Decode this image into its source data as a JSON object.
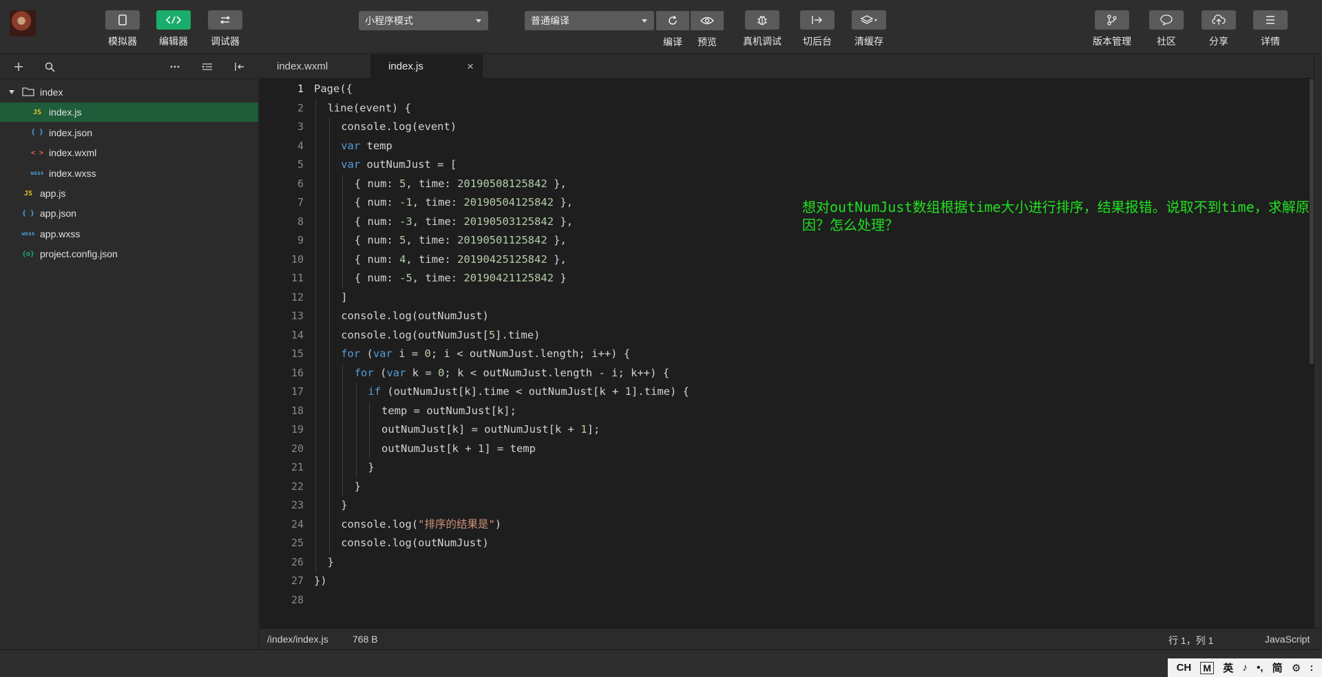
{
  "toolbar": {
    "left_buttons": [
      {
        "label": "模拟器",
        "icon": "phone-icon",
        "active": false
      },
      {
        "label": "编辑器",
        "icon": "code-icon",
        "active": true
      },
      {
        "label": "调试器",
        "icon": "debug-toggle-icon",
        "active": false
      }
    ],
    "mode_select": "小程序模式",
    "compile_select": "普通编译",
    "compile_label": "编译",
    "preview_label": "预览",
    "actions": [
      {
        "label": "真机调试",
        "icon": "bug-icon"
      },
      {
        "label": "切后台",
        "icon": "switch-background-icon"
      },
      {
        "label": "清缓存",
        "icon": "layers-icon"
      }
    ],
    "right_buttons": [
      {
        "label": "版本管理",
        "icon": "branch-icon"
      },
      {
        "label": "社区",
        "icon": "chat-icon"
      },
      {
        "label": "分享",
        "icon": "cloud-upload-icon"
      },
      {
        "label": "详情",
        "icon": "menu-icon"
      }
    ],
    "active_color": "#1aad6b"
  },
  "sidebar": {
    "tree": [
      {
        "label": "index",
        "type": "folder",
        "icon_text": "",
        "color": "#cfcfcf",
        "selected": false
      },
      {
        "label": "index.js",
        "type": "js",
        "icon_text": "JS",
        "color": "#e6c229",
        "selected": true
      },
      {
        "label": "index.json",
        "type": "json",
        "icon_text": "{ }",
        "color": "#4aa3df",
        "selected": false
      },
      {
        "label": "index.wxml",
        "type": "wxml",
        "icon_text": "< >",
        "color": "#e9663c",
        "selected": false
      },
      {
        "label": "index.wxss",
        "type": "wxss",
        "icon_text": "wxss",
        "color": "#4aa3df",
        "selected": false
      },
      {
        "label": "app.js",
        "type": "js",
        "icon_text": "JS",
        "color": "#e6c229",
        "selected": false
      },
      {
        "label": "app.json",
        "type": "json",
        "icon_text": "{ }",
        "color": "#4aa3df",
        "selected": false
      },
      {
        "label": "app.wxss",
        "type": "wxss",
        "icon_text": "wxss",
        "color": "#4aa3df",
        "selected": false
      },
      {
        "label": "project.config.json",
        "type": "config",
        "icon_text": "{o}",
        "color": "#1aad6b",
        "selected": false
      }
    ]
  },
  "tabs": [
    {
      "label": "index.wxml",
      "active": false
    },
    {
      "label": "index.js",
      "active": true,
      "close": "×"
    }
  ],
  "editor": {
    "current_line": 1,
    "lines": [
      {
        "indent": 0,
        "parts": [
          [
            "p",
            "Page({"
          ]
        ]
      },
      {
        "indent": 1,
        "parts": [
          [
            "p",
            "line(event) {"
          ]
        ]
      },
      {
        "indent": 2,
        "parts": [
          [
            "p",
            "console.log(event)"
          ]
        ]
      },
      {
        "indent": 2,
        "parts": [
          [
            "k",
            "var"
          ],
          [
            "p",
            " temp"
          ]
        ]
      },
      {
        "indent": 2,
        "parts": [
          [
            "k",
            "var"
          ],
          [
            "p",
            " outNumJust = ["
          ]
        ]
      },
      {
        "indent": 3,
        "parts": [
          [
            "p",
            "{ num: "
          ],
          [
            "n",
            "5"
          ],
          [
            "p",
            ", time: "
          ],
          [
            "n",
            "20190508125842"
          ],
          [
            "p",
            " },"
          ]
        ]
      },
      {
        "indent": 3,
        "parts": [
          [
            "p",
            "{ num: "
          ],
          [
            "n",
            "-1"
          ],
          [
            "p",
            ", time: "
          ],
          [
            "n",
            "20190504125842"
          ],
          [
            "p",
            " },"
          ]
        ]
      },
      {
        "indent": 3,
        "parts": [
          [
            "p",
            "{ num: "
          ],
          [
            "n",
            "-3"
          ],
          [
            "p",
            ", time: "
          ],
          [
            "n",
            "20190503125842"
          ],
          [
            "p",
            " },"
          ]
        ]
      },
      {
        "indent": 3,
        "parts": [
          [
            "p",
            "{ num: "
          ],
          [
            "n",
            "5"
          ],
          [
            "p",
            ", time: "
          ],
          [
            "n",
            "20190501125842"
          ],
          [
            "p",
            " },"
          ]
        ]
      },
      {
        "indent": 3,
        "parts": [
          [
            "p",
            "{ num: "
          ],
          [
            "n",
            "4"
          ],
          [
            "p",
            ", time: "
          ],
          [
            "n",
            "20190425125842"
          ],
          [
            "p",
            " },"
          ]
        ]
      },
      {
        "indent": 3,
        "parts": [
          [
            "p",
            "{ num: "
          ],
          [
            "n",
            "-5"
          ],
          [
            "p",
            ", time: "
          ],
          [
            "n",
            "20190421125842"
          ],
          [
            "p",
            " }"
          ]
        ]
      },
      {
        "indent": 2,
        "parts": [
          [
            "p",
            "]"
          ]
        ]
      },
      {
        "indent": 2,
        "parts": [
          [
            "p",
            "console.log(outNumJust)"
          ]
        ]
      },
      {
        "indent": 2,
        "parts": [
          [
            "p",
            "console.log(outNumJust["
          ],
          [
            "n",
            "5"
          ],
          [
            "p",
            "].time)"
          ]
        ]
      },
      {
        "indent": 2,
        "parts": [
          [
            "k",
            "for"
          ],
          [
            "p",
            " ("
          ],
          [
            "k",
            "var"
          ],
          [
            "p",
            " i = "
          ],
          [
            "n",
            "0"
          ],
          [
            "p",
            "; i < outNumJust.length; i++) {"
          ]
        ]
      },
      {
        "indent": 3,
        "parts": [
          [
            "k",
            "for"
          ],
          [
            "p",
            " ("
          ],
          [
            "k",
            "var"
          ],
          [
            "p",
            " k = "
          ],
          [
            "n",
            "0"
          ],
          [
            "p",
            "; k < outNumJust.length - i; k++) {"
          ]
        ]
      },
      {
        "indent": 4,
        "parts": [
          [
            "k",
            "if"
          ],
          [
            "p",
            " (outNumJust[k].time < outNumJust[k + "
          ],
          [
            "n",
            "1"
          ],
          [
            "p",
            "].time) {"
          ]
        ]
      },
      {
        "indent": 5,
        "parts": [
          [
            "p",
            "temp = outNumJust[k];"
          ]
        ]
      },
      {
        "indent": 5,
        "parts": [
          [
            "p",
            "outNumJust[k] = outNumJust[k + "
          ],
          [
            "n",
            "1"
          ],
          [
            "p",
            "];"
          ]
        ]
      },
      {
        "indent": 5,
        "parts": [
          [
            "p",
            "outNumJust[k + "
          ],
          [
            "n",
            "1"
          ],
          [
            "p",
            "] = temp"
          ]
        ]
      },
      {
        "indent": 4,
        "parts": [
          [
            "p",
            "}"
          ]
        ]
      },
      {
        "indent": 3,
        "parts": [
          [
            "p",
            "}"
          ]
        ]
      },
      {
        "indent": 2,
        "parts": [
          [
            "p",
            "}"
          ]
        ]
      },
      {
        "indent": 2,
        "parts": [
          [
            "p",
            "console.log("
          ],
          [
            "s",
            "\"排序的结果是\""
          ],
          [
            "p",
            ")"
          ]
        ]
      },
      {
        "indent": 2,
        "parts": [
          [
            "p",
            "console.log(outNumJust)"
          ]
        ]
      },
      {
        "indent": 1,
        "parts": [
          [
            "p",
            "}"
          ]
        ]
      },
      {
        "indent": 0,
        "parts": [
          [
            "p",
            "})"
          ]
        ]
      },
      {
        "indent": 0,
        "parts": []
      }
    ],
    "question_overlay": "想对outNumJust数组根据time大小进行排序，结果报错。说取不到time，求解原因？怎么处理？",
    "question_color": "#21e021"
  },
  "status": {
    "path": "/index/index.js",
    "size": "768 B",
    "cursor": "行 1，列 1",
    "language": "JavaScript"
  },
  "ime": {
    "items": [
      "CH",
      "M",
      "英",
      "♪",
      "•,",
      "简",
      "⚙",
      ":"
    ]
  }
}
